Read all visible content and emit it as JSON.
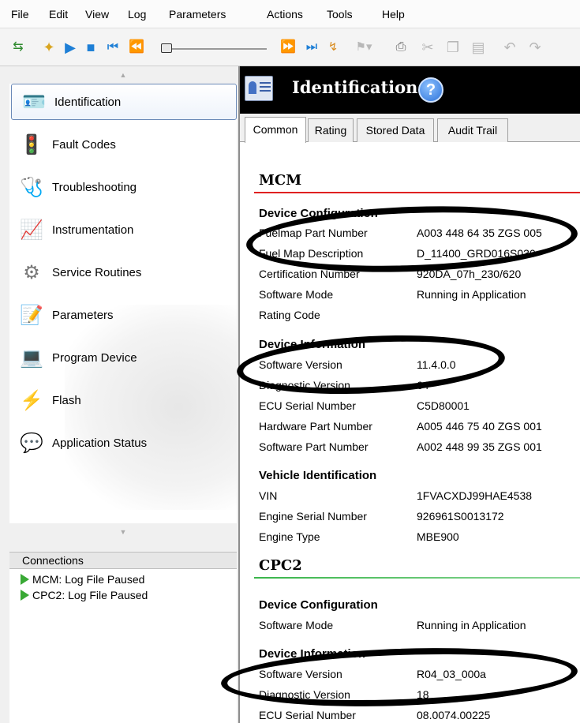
{
  "menu": [
    "File",
    "Edit",
    "View",
    "Log",
    "Parameters",
    "Actions",
    "Tools",
    "Help"
  ],
  "toolbar": {
    "icons": [
      "swap-arrows-icon",
      "open-folder-icon",
      "play-icon",
      "stop-icon",
      "skip-start-icon",
      "rewind-icon",
      "fast-forward-icon",
      "skip-end-icon",
      "step-icon",
      "flag-icon",
      "print-icon",
      "cut-icon",
      "copy-icon",
      "paste-icon",
      "undo-icon",
      "redo-icon"
    ],
    "accent": "#1e7fd6"
  },
  "nav": {
    "items": [
      {
        "label": "Identification",
        "icon": "id-card-icon",
        "selected": true
      },
      {
        "label": "Fault Codes",
        "icon": "traffic-light-icon",
        "selected": false
      },
      {
        "label": "Troubleshooting",
        "icon": "stethoscope-icon",
        "selected": false
      },
      {
        "label": "Instrumentation",
        "icon": "graph-icon",
        "selected": false
      },
      {
        "label": "Service Routines",
        "icon": "gears-icon",
        "selected": false
      },
      {
        "label": "Parameters",
        "icon": "notepad-icon",
        "selected": false
      },
      {
        "label": "Program Device",
        "icon": "computer-icon",
        "selected": false
      },
      {
        "label": "Flash",
        "icon": "flash-arrow-icon",
        "selected": false
      },
      {
        "label": "Application Status",
        "icon": "speech-bubbles-icon",
        "selected": false
      }
    ]
  },
  "connections": {
    "header": "Connections",
    "items": [
      "MCM: Log File Paused",
      "CPC2: Log File Paused"
    ],
    "status_color": "#39a935"
  },
  "header": {
    "title": "Identification",
    "help_label": "?"
  },
  "tabs": [
    "Common",
    "Rating",
    "Stored Data",
    "Audit Trail"
  ],
  "sections": {
    "mcm": {
      "title": "MCM",
      "line_color": "#e02020",
      "groups": {
        "device_config": {
          "title": "Device Configuration",
          "rows": [
            {
              "label": "Fuelmap Part Number",
              "value": "A003 448 64 35 ZGS 005"
            },
            {
              "label": "Fuel Map Description",
              "value": "D_11400_GRD016S030"
            },
            {
              "label": "Certification Number",
              "value": "920DA_07h_230/620"
            },
            {
              "label": "Software Mode",
              "value": "Running in Application"
            },
            {
              "label": "Rating Code",
              "value": ""
            }
          ]
        },
        "device_info": {
          "title": "Device Information",
          "rows": [
            {
              "label": "Software Version",
              "value": "11.4.0.0"
            },
            {
              "label": "Diagnostic Version",
              "value": "64"
            },
            {
              "label": "ECU Serial Number",
              "value": "C5D80001"
            },
            {
              "label": "Hardware Part Number",
              "value": "A005 446 75 40 ZGS 001"
            },
            {
              "label": "Software Part Number",
              "value": "A002 448 99 35 ZGS 001"
            }
          ]
        },
        "vehicle_id": {
          "title": "Vehicle Identification",
          "rows": [
            {
              "label": "VIN",
              "value": "1FVACXDJ99HAE4538"
            },
            {
              "label": "Engine Serial Number",
              "value": "926961S0013172"
            },
            {
              "label": "Engine Type",
              "value": "MBE900"
            }
          ]
        }
      }
    },
    "cpc2": {
      "title": "CPC2",
      "line_color": "#39b54a",
      "groups": {
        "device_config": {
          "title": "Device Configuration",
          "rows": [
            {
              "label": "Software Mode",
              "value": "Running in Application"
            }
          ]
        },
        "device_info": {
          "title": "Device Information",
          "rows": [
            {
              "label": "Software Version",
              "value": "R04_03_000a"
            },
            {
              "label": "Diagnostic Version",
              "value": "18"
            },
            {
              "label": "ECU Serial Number",
              "value": "08.0074.00225"
            }
          ]
        }
      }
    }
  }
}
